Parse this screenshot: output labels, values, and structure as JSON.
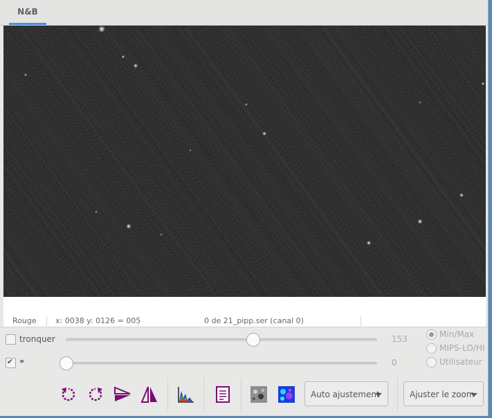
{
  "tab": {
    "label": "N&B"
  },
  "status": {
    "channel": "Rouge",
    "coords": "x: 0038 y: 0126 = 005",
    "frame": "0 de 21_pipp.ser (canal 0)"
  },
  "sliders": {
    "crop_label": "tronquer",
    "top_value": "153",
    "bottom_value": "0",
    "top_level": 0.6,
    "bottom_level": 0.0
  },
  "radios": [
    "Min/Max",
    "MIPS-LO/HI",
    "Utilisateur"
  ],
  "toolbar": {
    "auto_label": "Auto ajustement",
    "zoom_label": "Ajuster le zoom"
  },
  "colors": {
    "accent": "#4a90d9",
    "icon_purple": "#7a0a74",
    "image_bg": "#2b2b2b"
  },
  "icons": [
    "rotate-left-icon",
    "rotate-right-icon",
    "mirror-x-icon",
    "mirror-y-icon",
    "histogram-icon",
    "fits-header-icon",
    "negative-view-icon",
    "colormap-icon"
  ]
}
